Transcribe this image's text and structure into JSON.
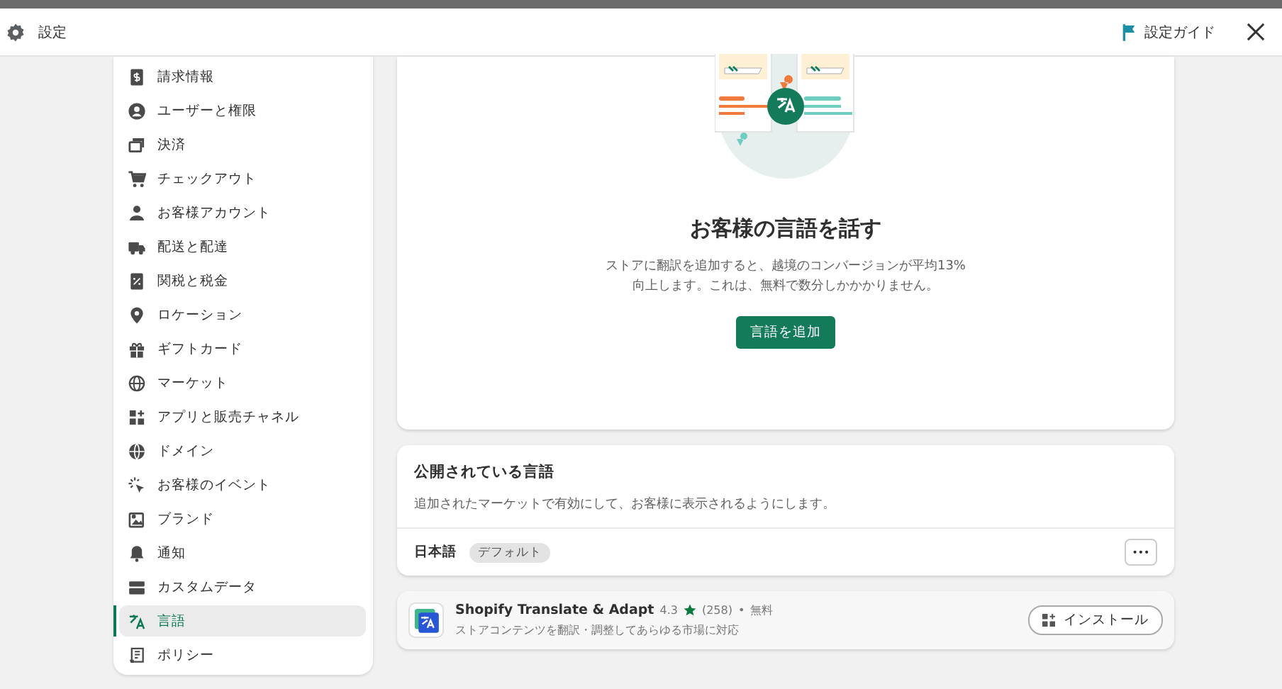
{
  "header": {
    "title": "設定",
    "guide_link": "設定ガイド"
  },
  "sidebar": {
    "items": [
      {
        "label": "請求情報",
        "selected": false
      },
      {
        "label": "ユーザーと権限",
        "selected": false
      },
      {
        "label": "決済",
        "selected": false
      },
      {
        "label": "チェックアウト",
        "selected": false
      },
      {
        "label": "お客様アカウント",
        "selected": false
      },
      {
        "label": "配送と配達",
        "selected": false
      },
      {
        "label": "関税と税金",
        "selected": false
      },
      {
        "label": "ロケーション",
        "selected": false
      },
      {
        "label": "ギフトカード",
        "selected": false
      },
      {
        "label": "マーケット",
        "selected": false
      },
      {
        "label": "アプリと販売チャネル",
        "selected": false
      },
      {
        "label": "ドメイン",
        "selected": false
      },
      {
        "label": "お客様のイベント",
        "selected": false
      },
      {
        "label": "ブランド",
        "selected": false
      },
      {
        "label": "通知",
        "selected": false
      },
      {
        "label": "カスタムデータ",
        "selected": false
      },
      {
        "label": "言語",
        "selected": true
      },
      {
        "label": "ポリシー",
        "selected": false
      }
    ]
  },
  "hero": {
    "title": "お客様の言語を話す",
    "description": "ストアに翻訳を追加すると、越境のコンバージョンが平均13%\n向上します。これは、無料で数分しかかかりません。",
    "button": "言語を追加"
  },
  "published": {
    "title": "公開されている言語",
    "description": "追加されたマーケットで有効にして、お客様に表示されるようにします。",
    "languages": [
      {
        "name": "日本語",
        "badge": "デフォルト",
        "more": "•••"
      }
    ]
  },
  "app": {
    "name": "Shopify Translate & Adapt",
    "rating": "4.3",
    "reviews": "(258)",
    "separator": "•",
    "price": "無料",
    "description": "ストアコンテンツを翻訳・調整してあらゆる市場に対応",
    "button": "インストール"
  }
}
